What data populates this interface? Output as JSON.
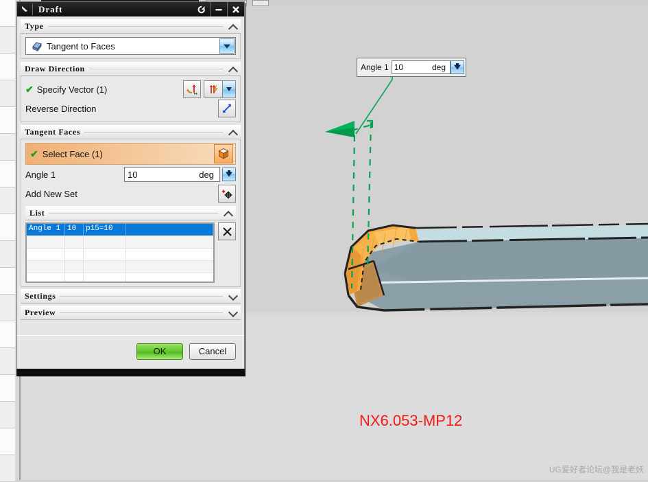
{
  "dialog": {
    "title": "Draft",
    "titlebar": {
      "menu_icon": "dialog-menu-icon",
      "reset_label": "↺",
      "minimize_label": "–",
      "close_label": "✕"
    },
    "sections": {
      "type": {
        "header": "Type",
        "combo_value": "Tangent to Faces",
        "combo_icon": "draft-type-icon"
      },
      "draw_direction": {
        "header": "Draw Direction",
        "specify_vector_label": "Specify Vector (1)",
        "specify_vector_checked": "✔",
        "reverse_direction_label": "Reverse Direction",
        "vector_constructor_icon": "vector-constructor-icon",
        "vector_inference_icon": "vector-inference-icon",
        "reverse_icon": "reverse-direction-icon"
      },
      "tangent_faces": {
        "header": "Tangent Faces",
        "select_face_label": "Select Face (1)",
        "select_face_checked": "✔",
        "select_face_icon": "face-select-cube-icon",
        "angle_label": "Angle 1",
        "angle_value": "10",
        "angle_unit": "deg",
        "add_new_set_label": "Add New Set",
        "add_new_set_icon": "add-new-set-icon"
      },
      "list": {
        "header": "List",
        "delete_icon": "delete-x-icon",
        "rows": [
          {
            "name": "Angle 1",
            "value": "10",
            "expression": "p15=10",
            "extra": ""
          },
          {
            "name": "",
            "value": "",
            "expression": "",
            "extra": ""
          },
          {
            "name": "",
            "value": "",
            "expression": "",
            "extra": ""
          },
          {
            "name": "",
            "value": "",
            "expression": "",
            "extra": ""
          },
          {
            "name": "",
            "value": "",
            "expression": "",
            "extra": ""
          }
        ]
      },
      "settings": {
        "header": "Settings"
      },
      "preview": {
        "header": "Preview"
      }
    },
    "footer": {
      "ok_label": "OK",
      "cancel_label": "Cancel"
    }
  },
  "floating_input": {
    "label": "Angle 1",
    "value": "10",
    "unit": "deg",
    "stepper_icon": "blue-down-arrow-icon"
  },
  "viewport": {
    "version_watermark": "NX6.053-MP12",
    "forum_watermark": "UG爱好者论坛@我是老妖"
  },
  "colors": {
    "background": "#d2d2d2",
    "selected_face": "#f5a93e",
    "body_face": "#869aa2",
    "body_top": "#c3dde3",
    "vector": "#00b050",
    "list_selection": "#0a78d7",
    "ok_button": "#63c52b",
    "version_text": "#f01b17"
  }
}
